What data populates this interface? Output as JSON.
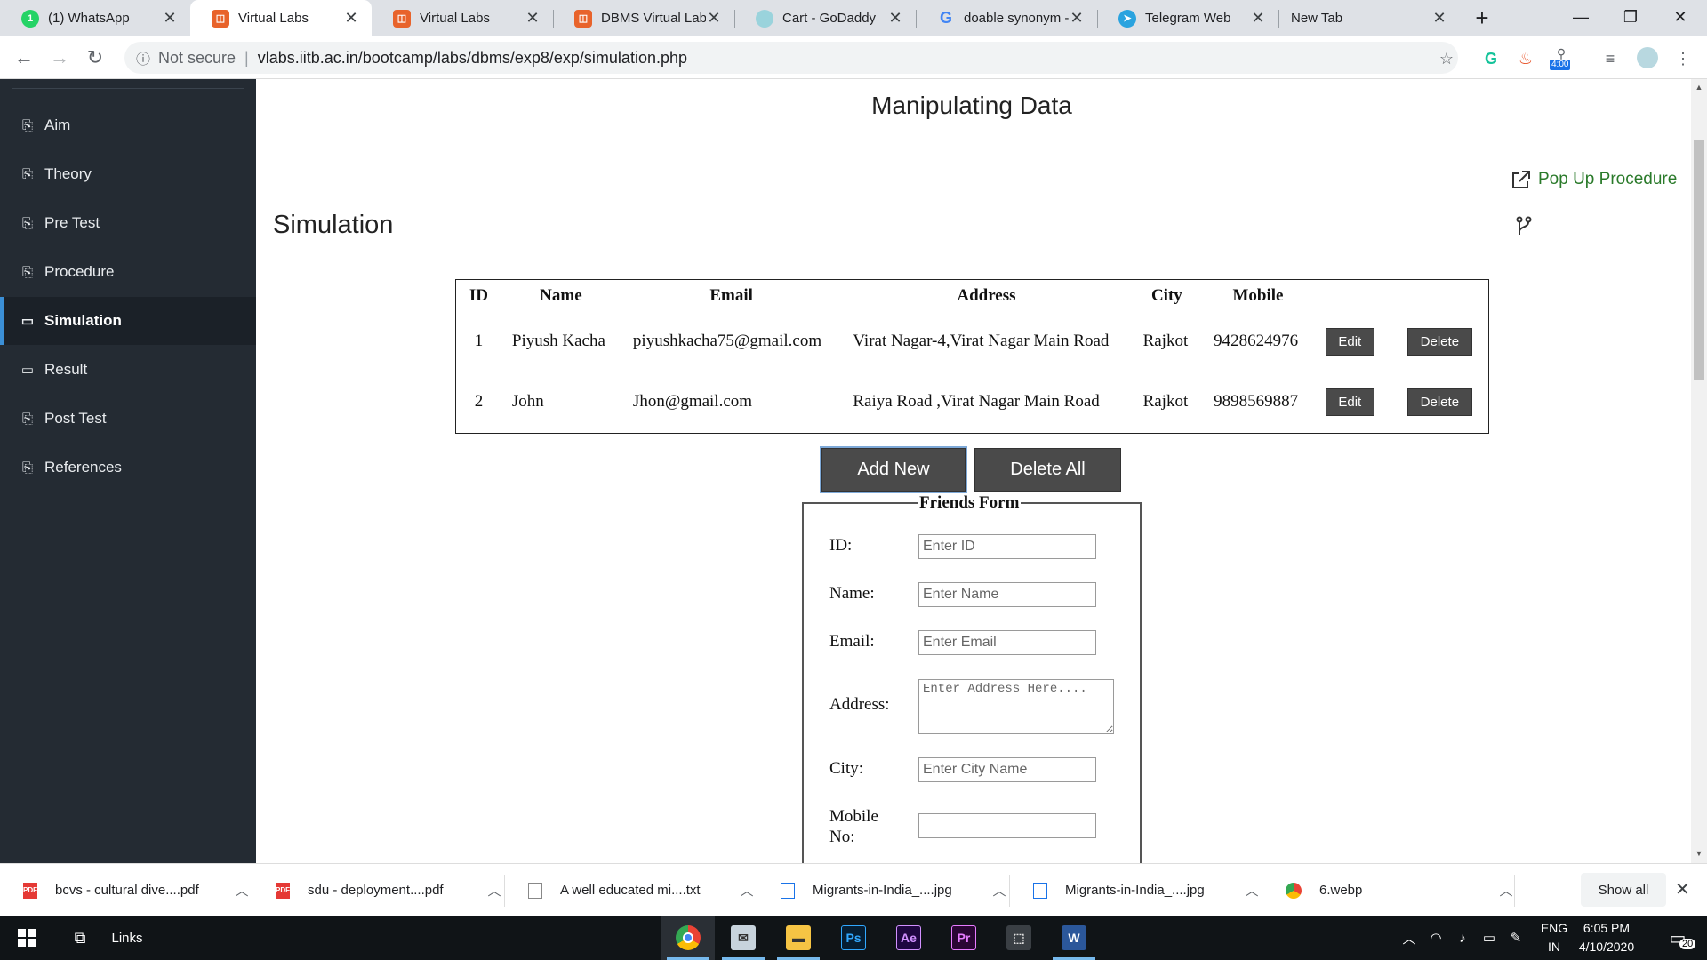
{
  "browser": {
    "tabs": [
      {
        "title": "(1) WhatsApp",
        "icon": "whatsapp-icon",
        "active": false
      },
      {
        "title": "Virtual Labs",
        "icon": "virtual-labs-icon",
        "active": true
      },
      {
        "title": "Virtual Labs",
        "icon": "virtual-labs-icon",
        "active": false
      },
      {
        "title": "DBMS Virtual Lab",
        "icon": "virtual-labs-icon",
        "active": false
      },
      {
        "title": "Cart - GoDaddy",
        "icon": "godaddy-icon",
        "active": false
      },
      {
        "title": "doable synonym -",
        "icon": "google-icon",
        "active": false
      },
      {
        "title": "Telegram Web",
        "icon": "telegram-icon",
        "active": false
      },
      {
        "title": "New Tab",
        "icon": "",
        "active": false
      }
    ],
    "security": "Not secure",
    "url": "vlabs.iitb.ac.in/bootcamp/labs/dbms/exp8/exp/simulation.php",
    "extension_badge": "4:00"
  },
  "sidebar": {
    "items": [
      {
        "label": "Aim",
        "icon": "document-icon",
        "active": false
      },
      {
        "label": "Theory",
        "icon": "document-icon",
        "active": false
      },
      {
        "label": "Pre Test",
        "icon": "document-icon",
        "active": false
      },
      {
        "label": "Procedure",
        "icon": "document-icon",
        "active": false
      },
      {
        "label": "Simulation",
        "icon": "laptop-icon",
        "active": true
      },
      {
        "label": "Result",
        "icon": "laptop-icon",
        "active": false
      },
      {
        "label": "Post Test",
        "icon": "document-icon",
        "active": false
      },
      {
        "label": "References",
        "icon": "document-icon",
        "active": false
      }
    ]
  },
  "main": {
    "experiment_title": "Manipulating Data",
    "popup_label": "Pop Up Procedure",
    "section_title": "Simulation",
    "table": {
      "headers": [
        "ID",
        "Name",
        "Email",
        "Address",
        "City",
        "Mobile"
      ],
      "rows": [
        {
          "id": "1",
          "name": "Piyush Kacha",
          "email": "piyushkacha75@gmail.com",
          "address": "Virat Nagar-4,Virat Nagar Main Road",
          "city": "Rajkot",
          "mobile": "9428624976"
        },
        {
          "id": "2",
          "name": "John",
          "email": "Jhon@gmail.com",
          "address": "Raiya Road ,Virat Nagar Main Road",
          "city": "Rajkot",
          "mobile": "9898569887"
        }
      ],
      "edit_label": "Edit",
      "delete_label": "Delete"
    },
    "add_new_label": "Add New",
    "delete_all_label": "Delete All",
    "form": {
      "legend": "Friends Form",
      "id_label": "ID:",
      "id_placeholder": "Enter ID",
      "name_label": "Name:",
      "name_placeholder": "Enter Name",
      "email_label": "Email:",
      "email_placeholder": "Enter Email",
      "address_label": "Address:",
      "address_placeholder": "Enter Address Here....",
      "city_label": "City:",
      "city_placeholder": "Enter City Name",
      "mobile_label_1": "Mobile",
      "mobile_label_2": "No:",
      "mobile_placeholder": ""
    }
  },
  "downloads": {
    "items": [
      {
        "name": "bcvs - cultural dive....pdf",
        "type": "pdf"
      },
      {
        "name": "sdu - deployment....pdf",
        "type": "pdf"
      },
      {
        "name": "A well educated mi....txt",
        "type": "txt"
      },
      {
        "name": "Migrants-in-India_....jpg",
        "type": "jpg"
      },
      {
        "name": "Migrants-in-India_....jpg",
        "type": "jpg"
      },
      {
        "name": "6.webp",
        "type": "webp"
      }
    ],
    "show_all_label": "Show all"
  },
  "taskbar": {
    "links_label": "Links",
    "apps": [
      "chrome",
      "mail",
      "file-explorer",
      "photoshop",
      "after-effects",
      "premiere",
      "app",
      "word"
    ],
    "ps_label": "Ps",
    "ae_label": "Ae",
    "pr_label": "Pr",
    "word_label": "W",
    "lang_1": "ENG",
    "lang_2": "IN",
    "time": "6:05 PM",
    "date": "4/10/2020",
    "notification_count": "20"
  },
  "colors": {
    "sidebar_bg": "#242b33",
    "popup_green": "#2a7a2a",
    "button_gray": "#4a4a4a",
    "vlabs_orange": "#e8632b"
  }
}
